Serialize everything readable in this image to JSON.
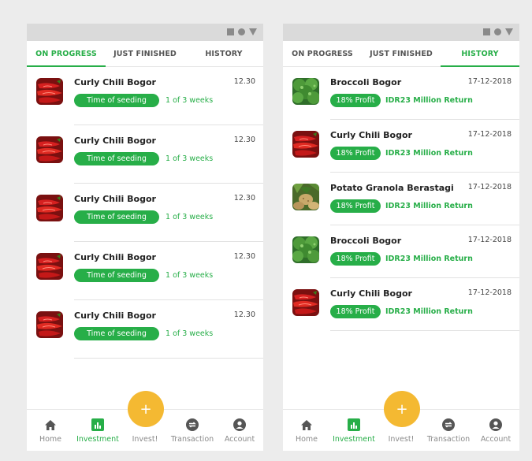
{
  "colors": {
    "accent": "#27ae48",
    "fab": "#f4b932"
  },
  "left_screen": {
    "tabs": [
      {
        "label": "ON PROGRESS",
        "active": true
      },
      {
        "label": "JUST FINISHED",
        "active": false
      },
      {
        "label": "HISTORY",
        "active": false
      }
    ],
    "items": [
      {
        "title": "Curly Chili Bogor",
        "time": "12.30",
        "badge": "Time of seeding",
        "note": "1 of 3 weeks",
        "image": "chili"
      },
      {
        "title": "Curly Chili Bogor",
        "time": "12.30",
        "badge": "Time of seeding",
        "note": "1 of 3 weeks",
        "image": "chili"
      },
      {
        "title": "Curly Chili Bogor",
        "time": "12.30",
        "badge": "Time of seeding",
        "note": "1 of 3 weeks",
        "image": "chili"
      },
      {
        "title": "Curly Chili Bogor",
        "time": "12.30",
        "badge": "Time of seeding",
        "note": "1 of 3 weeks",
        "image": "chili"
      },
      {
        "title": "Curly Chili Bogor",
        "time": "12.30",
        "badge": "Time of seeding",
        "note": "1 of 3 weeks",
        "image": "chili"
      }
    ]
  },
  "right_screen": {
    "tabs": [
      {
        "label": "ON PROGRESS",
        "active": false
      },
      {
        "label": "JUST FINISHED",
        "active": false
      },
      {
        "label": "HISTORY",
        "active": true
      }
    ],
    "items": [
      {
        "title": "Broccoli  Bogor",
        "date": "17-12-2018",
        "badge": "18% Profit",
        "note": "IDR23 Million Return",
        "image": "broccoli"
      },
      {
        "title": "Curly Chili  Bogor",
        "date": "17-12-2018",
        "badge": "18% Profit",
        "note": "IDR23 Million Return",
        "image": "chili"
      },
      {
        "title": "Potato Granola Berastagi",
        "date": "17-12-2018",
        "badge": "18% Profit",
        "note": "IDR23 Million Return",
        "image": "potato"
      },
      {
        "title": "Broccoli Bogor",
        "date": "17-12-2018",
        "badge": "18% Profit",
        "note": "IDR23 Million Return",
        "image": "broccoli"
      },
      {
        "title": "Curly Chili Bogor",
        "date": "17-12-2018",
        "badge": "18% Profit",
        "note": "IDR23 Million Return",
        "image": "chili"
      }
    ]
  },
  "bottom_nav": {
    "items": [
      {
        "label": "Home",
        "icon": "home-icon",
        "active": false
      },
      {
        "label": "Investment",
        "icon": "chart-icon",
        "active": true
      },
      {
        "label": "Invest!",
        "icon": "plus-icon",
        "active": false
      },
      {
        "label": "Transaction",
        "icon": "exchange-icon",
        "active": false
      },
      {
        "label": "Account",
        "icon": "user-icon",
        "active": false
      }
    ],
    "fab_symbol": "+"
  }
}
